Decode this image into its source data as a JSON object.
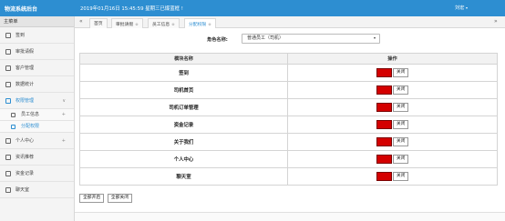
{
  "header": {
    "app_title": "物流系统后台",
    "datetime": "2019年01月16日 15:45:59 星期三已爆蓝框 !",
    "user_label": "刘宏"
  },
  "sidebar": {
    "head_label": "主菜单",
    "items": [
      {
        "label": "签到",
        "icon": "pencil-icon"
      },
      {
        "label": "审批请假",
        "icon": "clipboard-icon"
      },
      {
        "label": "客户管理",
        "icon": "people-icon"
      },
      {
        "label": "数据统计",
        "icon": "chart-icon"
      },
      {
        "label": "权限管理",
        "icon": "key-icon",
        "arrow": "∨"
      },
      {
        "label": "员工信息",
        "icon": "person-icon",
        "arrow": "+"
      },
      {
        "label": "分配权限",
        "icon": "tag-icon"
      },
      {
        "label": "个人中心",
        "icon": "user-icon",
        "arrow": "+"
      },
      {
        "label": "资讯推荐",
        "icon": "news-icon"
      },
      {
        "label": "资金记录",
        "icon": "wallet-icon"
      },
      {
        "label": "聊天室",
        "icon": "chat-icon"
      }
    ]
  },
  "tabs": {
    "left_scroll": "«",
    "right_scroll": "»",
    "items": [
      {
        "label": "首页",
        "close": ""
      },
      {
        "label": "审批请假",
        "close": "⊗"
      },
      {
        "label": "员工信息",
        "close": "⊗"
      },
      {
        "label": "分配权限",
        "close": "⊗"
      }
    ]
  },
  "form": {
    "role_label": "角色名称:",
    "role_value": "普通员工（司机）"
  },
  "table": {
    "headers": [
      "模块名称",
      "操作"
    ],
    "rows": [
      {
        "name": "签到",
        "open": "开启",
        "close": "关闭"
      },
      {
        "name": "司机首页",
        "open": "开启",
        "close": "关闭"
      },
      {
        "name": "司机订单管理",
        "open": "开启",
        "close": "关闭"
      },
      {
        "name": "资金记录",
        "open": "开启",
        "close": "关闭"
      },
      {
        "name": "关于我们",
        "open": "开启",
        "close": "关闭"
      },
      {
        "name": "个人中心",
        "open": "开启",
        "close": "关闭"
      },
      {
        "name": "聊天室",
        "open": "开启",
        "close": "关闭"
      }
    ]
  },
  "actions": {
    "open_all": "全部开启",
    "close_all": "全部关闭"
  },
  "colors": {
    "header_blue": "#2d8ed1",
    "open_button_red": "#d40000"
  }
}
